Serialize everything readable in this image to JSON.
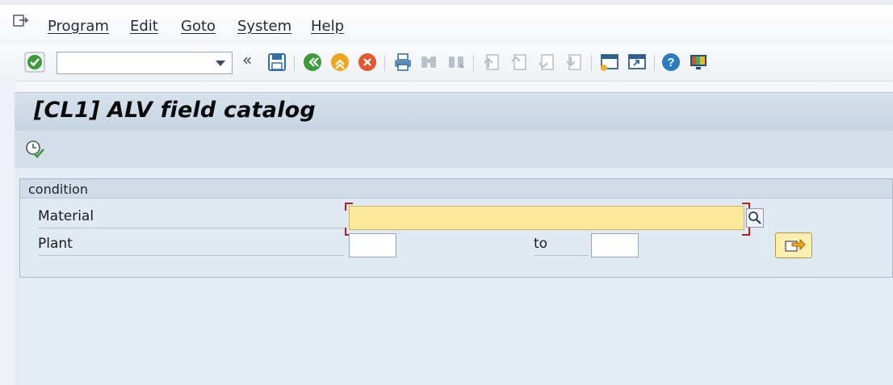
{
  "menu": {
    "items": [
      {
        "label": "Program"
      },
      {
        "label": "Edit"
      },
      {
        "label": "Goto"
      },
      {
        "label": "System"
      },
      {
        "label": "Help"
      }
    ]
  },
  "toolbar": {
    "command_value": "",
    "icons": [
      "enter-icon",
      "command-field",
      "back-double-icon",
      "save-icon",
      "back-icon",
      "exit-icon",
      "cancel-icon",
      "print-icon",
      "find-icon",
      "find-next-icon",
      "first-page-icon",
      "prev-page-icon",
      "next-page-icon",
      "last-page-icon",
      "new-session-icon",
      "shortcut-icon",
      "help-icon",
      "customize-layout-icon"
    ]
  },
  "title": "[CL1] ALV field catalog",
  "app_toolbar": {
    "execute_icon": "execute-icon"
  },
  "group": {
    "title": "condition",
    "material_label": "Material",
    "material_value": "",
    "plant_label": "Plant",
    "plant_from": "",
    "to_label": "to",
    "plant_to": ""
  },
  "colors": {
    "required_field": "#fce89a",
    "title_band": "#c6d4e2",
    "content_bg": "#e3ebf3"
  }
}
